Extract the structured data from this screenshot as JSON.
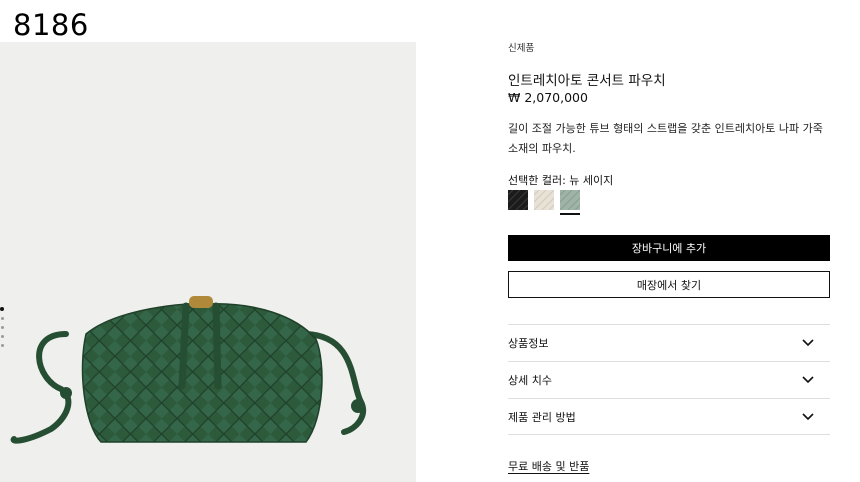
{
  "corner_number": "8186",
  "product": {
    "badge": "신제품",
    "title": "인트레치아토 콘서트 파우치",
    "price": "₩ 2,070,000",
    "description": "길이 조절 가능한 튜브 형태의 스트랩을 갖춘 인트레치아토 나파 가죽 소재의 파우치.",
    "selected_color_label": "선택한 컬러: 뉴 세이지",
    "swatches": [
      {
        "name": "black",
        "color": "#1b1b1b"
      },
      {
        "name": "cream",
        "color": "#e8e2d6"
      },
      {
        "name": "sage",
        "color": "#9fb3a6",
        "selected": true
      }
    ]
  },
  "gallery": {
    "image_count": 5,
    "active_index": 0,
    "bag_color": "#2d5a3a"
  },
  "buttons": {
    "add_to_cart": "장바구니에 추가",
    "find_in_store": "매장에서 찾기"
  },
  "accordion": [
    {
      "label": "상품정보"
    },
    {
      "label": "상세 치수"
    },
    {
      "label": "제품 관리 방법"
    }
  ],
  "shipping_link": "무료 배송 및 반품"
}
